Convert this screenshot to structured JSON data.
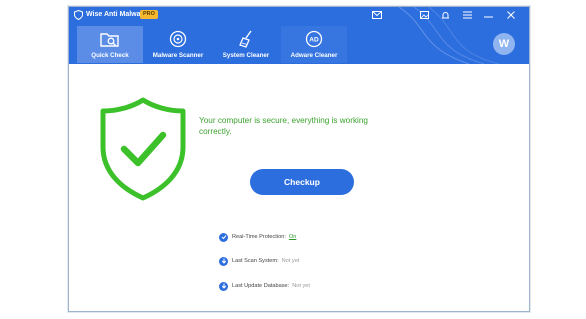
{
  "app": {
    "title": "Wise Anti Malware",
    "version": "PRO"
  },
  "window_controls": {
    "mail_icon": "mail-icon",
    "icons": [
      "image-icon",
      "bell-icon",
      "menu-icon",
      "minimize-icon",
      "close-icon"
    ]
  },
  "nav": {
    "tabs": [
      {
        "label": "Quick Check",
        "icon": "folder-search-icon",
        "active": true
      },
      {
        "label": "Malware Scanner",
        "icon": "radar-icon",
        "active": false
      },
      {
        "label": "System Cleaner",
        "icon": "broom-icon",
        "active": false
      },
      {
        "label": "Adware Cleaner",
        "icon": "ad-icon",
        "active": false
      }
    ],
    "avatar_letter": "W"
  },
  "main": {
    "status_message": "Your computer is secure, everything is working correctly.",
    "checkup_button": "Checkup",
    "info": [
      {
        "label": "Real-Time Protection:",
        "value": "On",
        "icon": "shield-check-icon"
      },
      {
        "label": "Last Scan System:",
        "value": "Not yet",
        "icon": "download-icon"
      },
      {
        "label": "Last Update Database:",
        "value": "Not yet",
        "icon": "download-icon"
      }
    ]
  },
  "colors": {
    "accent": "#2d6edf",
    "shield_green": "#3cc12a",
    "status_text": "#3ca12f"
  }
}
